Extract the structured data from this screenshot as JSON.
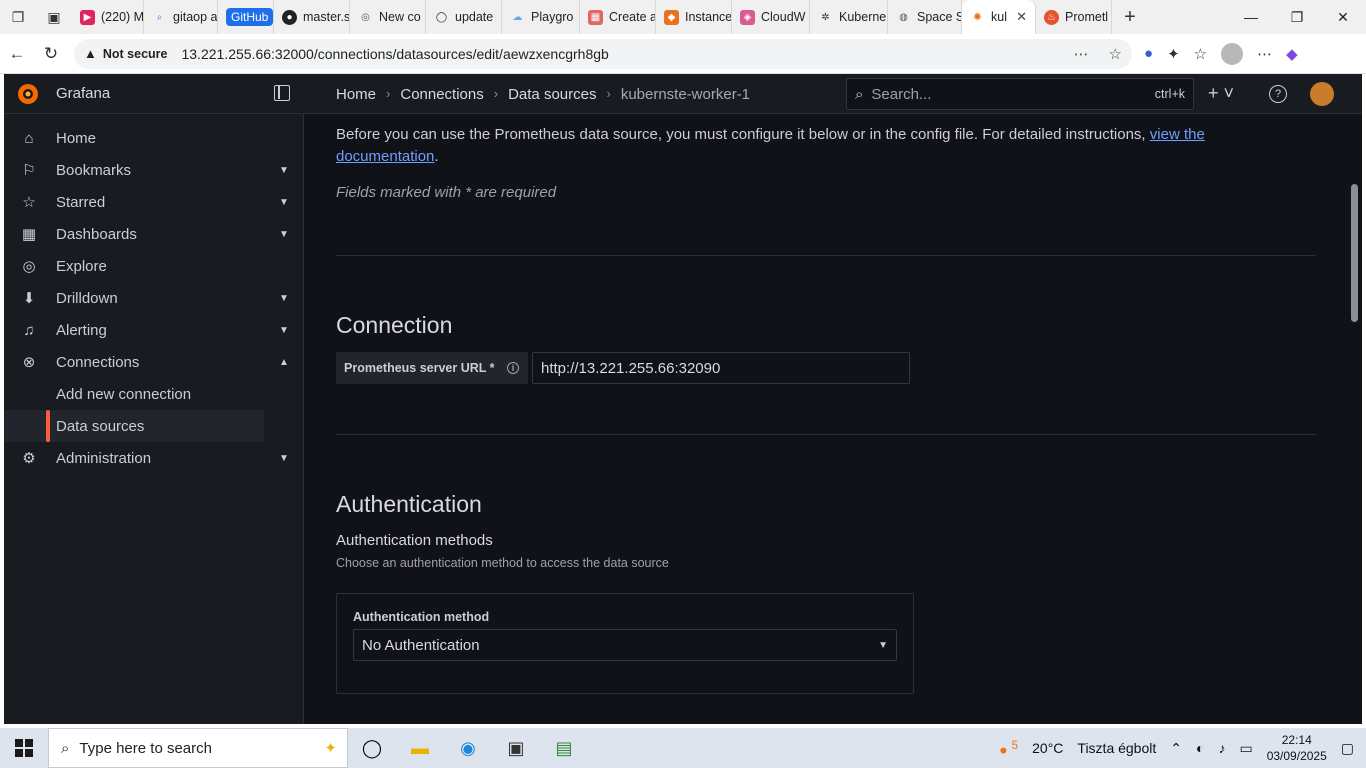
{
  "browser": {
    "tabs": [
      {
        "label": "(220) M",
        "icon": "youtube-icon",
        "color": "#e0245e"
      },
      {
        "label": "gitaop a",
        "icon": "search-icon",
        "color": "#5f6bf6"
      },
      {
        "label": "GitHub",
        "icon": "github-badge",
        "color": "#1f6feb"
      },
      {
        "label": "master.s",
        "icon": "github-icon",
        "color": "#222222"
      },
      {
        "label": "New co",
        "icon": "copilot-icon",
        "color": "#555555"
      },
      {
        "label": "update",
        "icon": "github-icon",
        "color": "#222222"
      },
      {
        "label": "Playgro",
        "icon": "cloud-icon",
        "color": "#6aa6e6"
      },
      {
        "label": "Create a",
        "icon": "calendar-icon",
        "color": "#e06666"
      },
      {
        "label": "Instance",
        "icon": "aws-icon",
        "color": "#e8731b"
      },
      {
        "label": "CloudW",
        "icon": "cloudwatch-icon",
        "color": "#d95a95"
      },
      {
        "label": "Kuberne",
        "icon": "kubernetes-icon",
        "color": "#333333"
      },
      {
        "label": "Space S",
        "icon": "globe-icon",
        "color": "#555555"
      },
      {
        "label": "kul",
        "icon": "grafana-icon",
        "color": "#f46800"
      },
      {
        "label": "Prometl",
        "icon": "prometheus-icon",
        "color": "#e6522c"
      }
    ],
    "not_secure": "Not secure",
    "url": "13.221.255.66:32000/connections/datasources/edit/aewzxencgrh8gb"
  },
  "grafana": {
    "brand": "Grafana",
    "breadcrumbs": [
      "Home",
      "Connections",
      "Data sources",
      "kubernste-worker-1"
    ],
    "search_placeholder": "Search...",
    "search_shortcut": "ctrl+k",
    "nav": [
      {
        "label": "Home",
        "icon": "home-icon"
      },
      {
        "label": "Bookmarks",
        "icon": "bookmark-icon"
      },
      {
        "label": "Starred",
        "icon": "star-icon"
      },
      {
        "label": "Dashboards",
        "icon": "dashboards-icon"
      },
      {
        "label": "Explore",
        "icon": "compass-icon"
      },
      {
        "label": "Drilldown",
        "icon": "drilldown-icon"
      },
      {
        "label": "Alerting",
        "icon": "bell-icon"
      },
      {
        "label": "Connections",
        "icon": "connections-icon"
      },
      {
        "label": "Add new connection",
        "icon": ""
      },
      {
        "label": "Data sources",
        "icon": ""
      },
      {
        "label": "Administration",
        "icon": "gear-icon"
      }
    ],
    "intro_text": "Before you can use the Prometheus data source, you must configure it below or in the config file. For detailed instructions,",
    "intro_link": "view the documentation",
    "intro_end": ".",
    "required_note": "Fields marked with * are required",
    "connection_heading": "Connection",
    "server_url_label": "Prometheus server URL *",
    "server_url_value": "http://13.221.255.66:32090",
    "authentication_heading": "Authentication",
    "auth_methods_title": "Authentication methods",
    "auth_methods_desc": "Choose an authentication method to access the data source",
    "auth_method_label": "Authentication method",
    "auth_method_value": "No Authentication",
    "accent_color": "#f55f3e"
  },
  "taskbar": {
    "search_placeholder": "Type here to search",
    "weather_temp": "20°C",
    "weather_desc": "Tiszta égbolt",
    "weather_badge": "5",
    "time": "22:14",
    "date": "03/09/2025"
  }
}
